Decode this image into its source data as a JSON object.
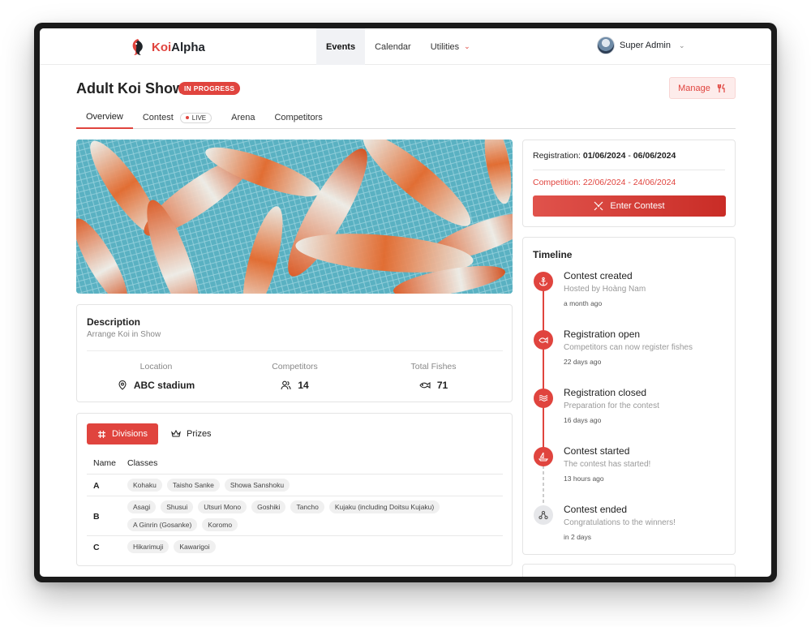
{
  "app": {
    "brand_prefix": "Koi",
    "brand_suffix": "Alpha"
  },
  "nav": {
    "items": [
      {
        "label": "Events",
        "active": true
      },
      {
        "label": "Calendar",
        "active": false
      },
      {
        "label": "Utilities",
        "active": false,
        "dropdown": true
      }
    ],
    "user": {
      "name": "Super Admin"
    }
  },
  "event": {
    "title": "Adult Koi Show",
    "status": "IN PROGRESS",
    "manage_label": "Manage"
  },
  "tabs": [
    {
      "label": "Overview",
      "active": true
    },
    {
      "label": "Contest",
      "active": false,
      "badge": "LIVE"
    },
    {
      "label": "Arena",
      "active": false
    },
    {
      "label": "Competitors",
      "active": false
    }
  ],
  "description": {
    "heading": "Description",
    "text": "Arrange Koi in Show",
    "stats": [
      {
        "label": "Location",
        "value": "ABC stadium",
        "icon": "location-pin-icon"
      },
      {
        "label": "Competitors",
        "value": "14",
        "icon": "users-icon"
      },
      {
        "label": "Total Fishes",
        "value": "71",
        "icon": "fish-icon"
      }
    ]
  },
  "divisions": {
    "tab_divisions": "Divisions",
    "tab_prizes": "Prizes",
    "col_name": "Name",
    "col_classes": "Classes",
    "rows": [
      {
        "name": "A",
        "classes": [
          "Kohaku",
          "Taisho Sanke",
          "Showa Sanshoku"
        ]
      },
      {
        "name": "B",
        "classes": [
          "Asagi",
          "Shusui",
          "Utsuri Mono",
          "Goshiki",
          "Tancho",
          "Kujaku (including Doitsu Kujaku)",
          "A Ginrin (Gosanke)",
          "Koromo"
        ]
      },
      {
        "name": "C",
        "classes": [
          "Hikarimuji",
          "Kawarigoi"
        ]
      }
    ]
  },
  "registration": {
    "reg_label": "Registration:",
    "reg_start": "01/06/2024",
    "reg_sep": " - ",
    "reg_end": "06/06/2024",
    "comp_text": "Competition: 22/06/2024 - 24/06/2024",
    "enter_label": "Enter Contest"
  },
  "timeline": {
    "heading": "Timeline",
    "items": [
      {
        "title": "Contest created",
        "desc": "Hosted by Hoàng Nam",
        "when": "a month ago",
        "icon": "anchor-icon",
        "done": true
      },
      {
        "title": "Registration open",
        "desc": "Competitors can now register fishes",
        "when": "22 days ago",
        "icon": "fish-icon",
        "done": true
      },
      {
        "title": "Registration closed",
        "desc": "Preparation for the contest",
        "when": "16 days ago",
        "icon": "waves-icon",
        "done": true
      },
      {
        "title": "Contest started",
        "desc": "The contest has started!",
        "when": "13 hours ago",
        "icon": "sailboat-icon",
        "done": true
      },
      {
        "title": "Contest ended",
        "desc": "Congratulations to the winners!",
        "when": "in 2 days",
        "icon": "trophy-network-icon",
        "done": false
      }
    ]
  },
  "colors": {
    "accent": "#e0443e",
    "accent_light": "#fdeceb"
  }
}
